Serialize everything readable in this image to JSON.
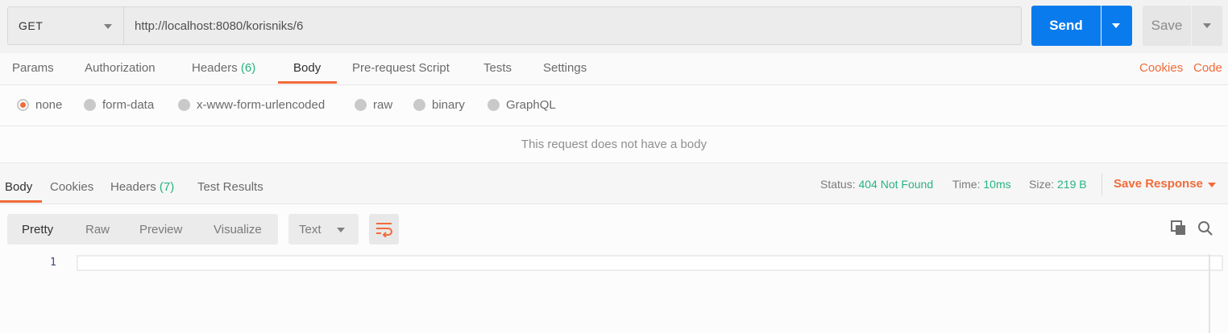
{
  "request": {
    "method": "GET",
    "url": "http://localhost:8080/korisniks/6",
    "send_label": "Send",
    "save_label": "Save"
  },
  "request_tabs": {
    "params": "Params",
    "authorization": "Authorization",
    "headers": "Headers",
    "headers_count": "(6)",
    "body": "Body",
    "prerequest": "Pre-request Script",
    "tests": "Tests",
    "settings": "Settings",
    "cookies": "Cookies",
    "code": "Code",
    "active": "Body"
  },
  "body_types": {
    "selected": "none",
    "options": [
      "none",
      "form-data",
      "x-www-form-urlencoded",
      "raw",
      "binary",
      "GraphQL"
    ]
  },
  "no_body_message": "This request does not have a body",
  "response": {
    "tabs": {
      "body": "Body",
      "cookies": "Cookies",
      "headers": "Headers",
      "headers_count": "(7)",
      "test_results": "Test Results",
      "active": "Body"
    },
    "status_label": "Status:",
    "status_value": "404 Not Found",
    "time_label": "Time:",
    "time_value": "10ms",
    "size_label": "Size:",
    "size_value": "219 B",
    "save_response": "Save Response"
  },
  "viewer": {
    "modes": [
      "Pretty",
      "Raw",
      "Preview",
      "Visualize"
    ],
    "active_mode": "Pretty",
    "format": "Text",
    "line_numbers": [
      "1"
    ]
  },
  "colors": {
    "accent": "#f26b3a",
    "primary": "#097bed",
    "success": "#26b47f"
  },
  "icons": [
    "chevron-down-icon",
    "wrap-lines-icon",
    "copy-icon",
    "search-icon"
  ]
}
